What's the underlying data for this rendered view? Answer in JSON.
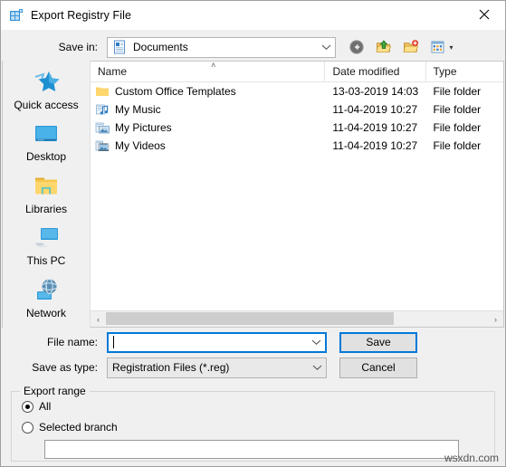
{
  "window": {
    "title": "Export Registry File",
    "app_icon": "registry-editor-icon",
    "close_label": "✕"
  },
  "savein": {
    "label": "Save in:",
    "value": "Documents",
    "icon": "documents-folder-icon",
    "arrow": "chevron-down-icon"
  },
  "toolbar": {
    "back": "back-arrow-icon",
    "up": "up-one-level-icon",
    "new_folder": "new-folder-icon",
    "views": "views-icon",
    "views_arrow": "▾"
  },
  "places": {
    "items": [
      {
        "label": "Quick access",
        "icon": "quick-access-star-icon"
      },
      {
        "label": "Desktop",
        "icon": "desktop-monitor-icon"
      },
      {
        "label": "Libraries",
        "icon": "libraries-folder-icon"
      },
      {
        "label": "This PC",
        "icon": "this-pc-icon"
      },
      {
        "label": "Network",
        "icon": "network-globe-icon"
      }
    ]
  },
  "filelist": {
    "columns": [
      "Name",
      "Date modified",
      "Type"
    ],
    "sort_indicator": "˄",
    "rows": [
      {
        "name": "Custom Office Templates",
        "date": "13-03-2019 14:03",
        "type": "File folder",
        "icon": "folder-icon"
      },
      {
        "name": "My Music",
        "date": "11-04-2019 10:27",
        "type": "File folder",
        "icon": "music-folder-icon"
      },
      {
        "name": "My Pictures",
        "date": "11-04-2019 10:27",
        "type": "File folder",
        "icon": "pictures-folder-icon"
      },
      {
        "name": "My Videos",
        "date": "11-04-2019 10:27",
        "type": "File folder",
        "icon": "videos-folder-icon"
      }
    ],
    "scroll_left_arrow": "‹",
    "scroll_right_arrow": "›"
  },
  "form": {
    "filename_label": "File name:",
    "filename_value": "",
    "filename_placeholder": "",
    "savetype_label": "Save as type:",
    "savetype_value": "Registration Files (*.reg)",
    "save_button": "Save",
    "cancel_button": "Cancel"
  },
  "export_range": {
    "title": "Export range",
    "options": [
      {
        "label": "All",
        "selected": true
      },
      {
        "label": "Selected branch",
        "selected": false
      }
    ],
    "branch_value": ""
  },
  "watermark": "wsxdn.com",
  "colors": {
    "accent": "#0078d7",
    "window_bg": "#f0f0f0",
    "list_bg": "#ffffff",
    "folder_yellow": "#ffd76e"
  }
}
